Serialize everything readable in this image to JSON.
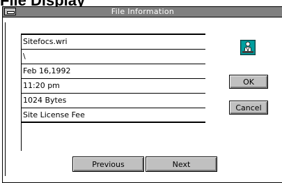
{
  "page_heading": "File Display",
  "dialog": {
    "title": "File Information",
    "icon": "person-at-desk-icon",
    "fields": [
      "Sitefocs.wri",
      "\\",
      "Feb 16,1992",
      "11:20 pm",
      "1024 Bytes",
      "Site License Fee"
    ],
    "buttons": {
      "ok": "OK",
      "cancel": "Cancel",
      "previous": "Previous",
      "next": "Next"
    }
  },
  "colors": {
    "titlebar": "#808080",
    "button_face": "#c0c0c0",
    "icon_teal": "#008080"
  }
}
